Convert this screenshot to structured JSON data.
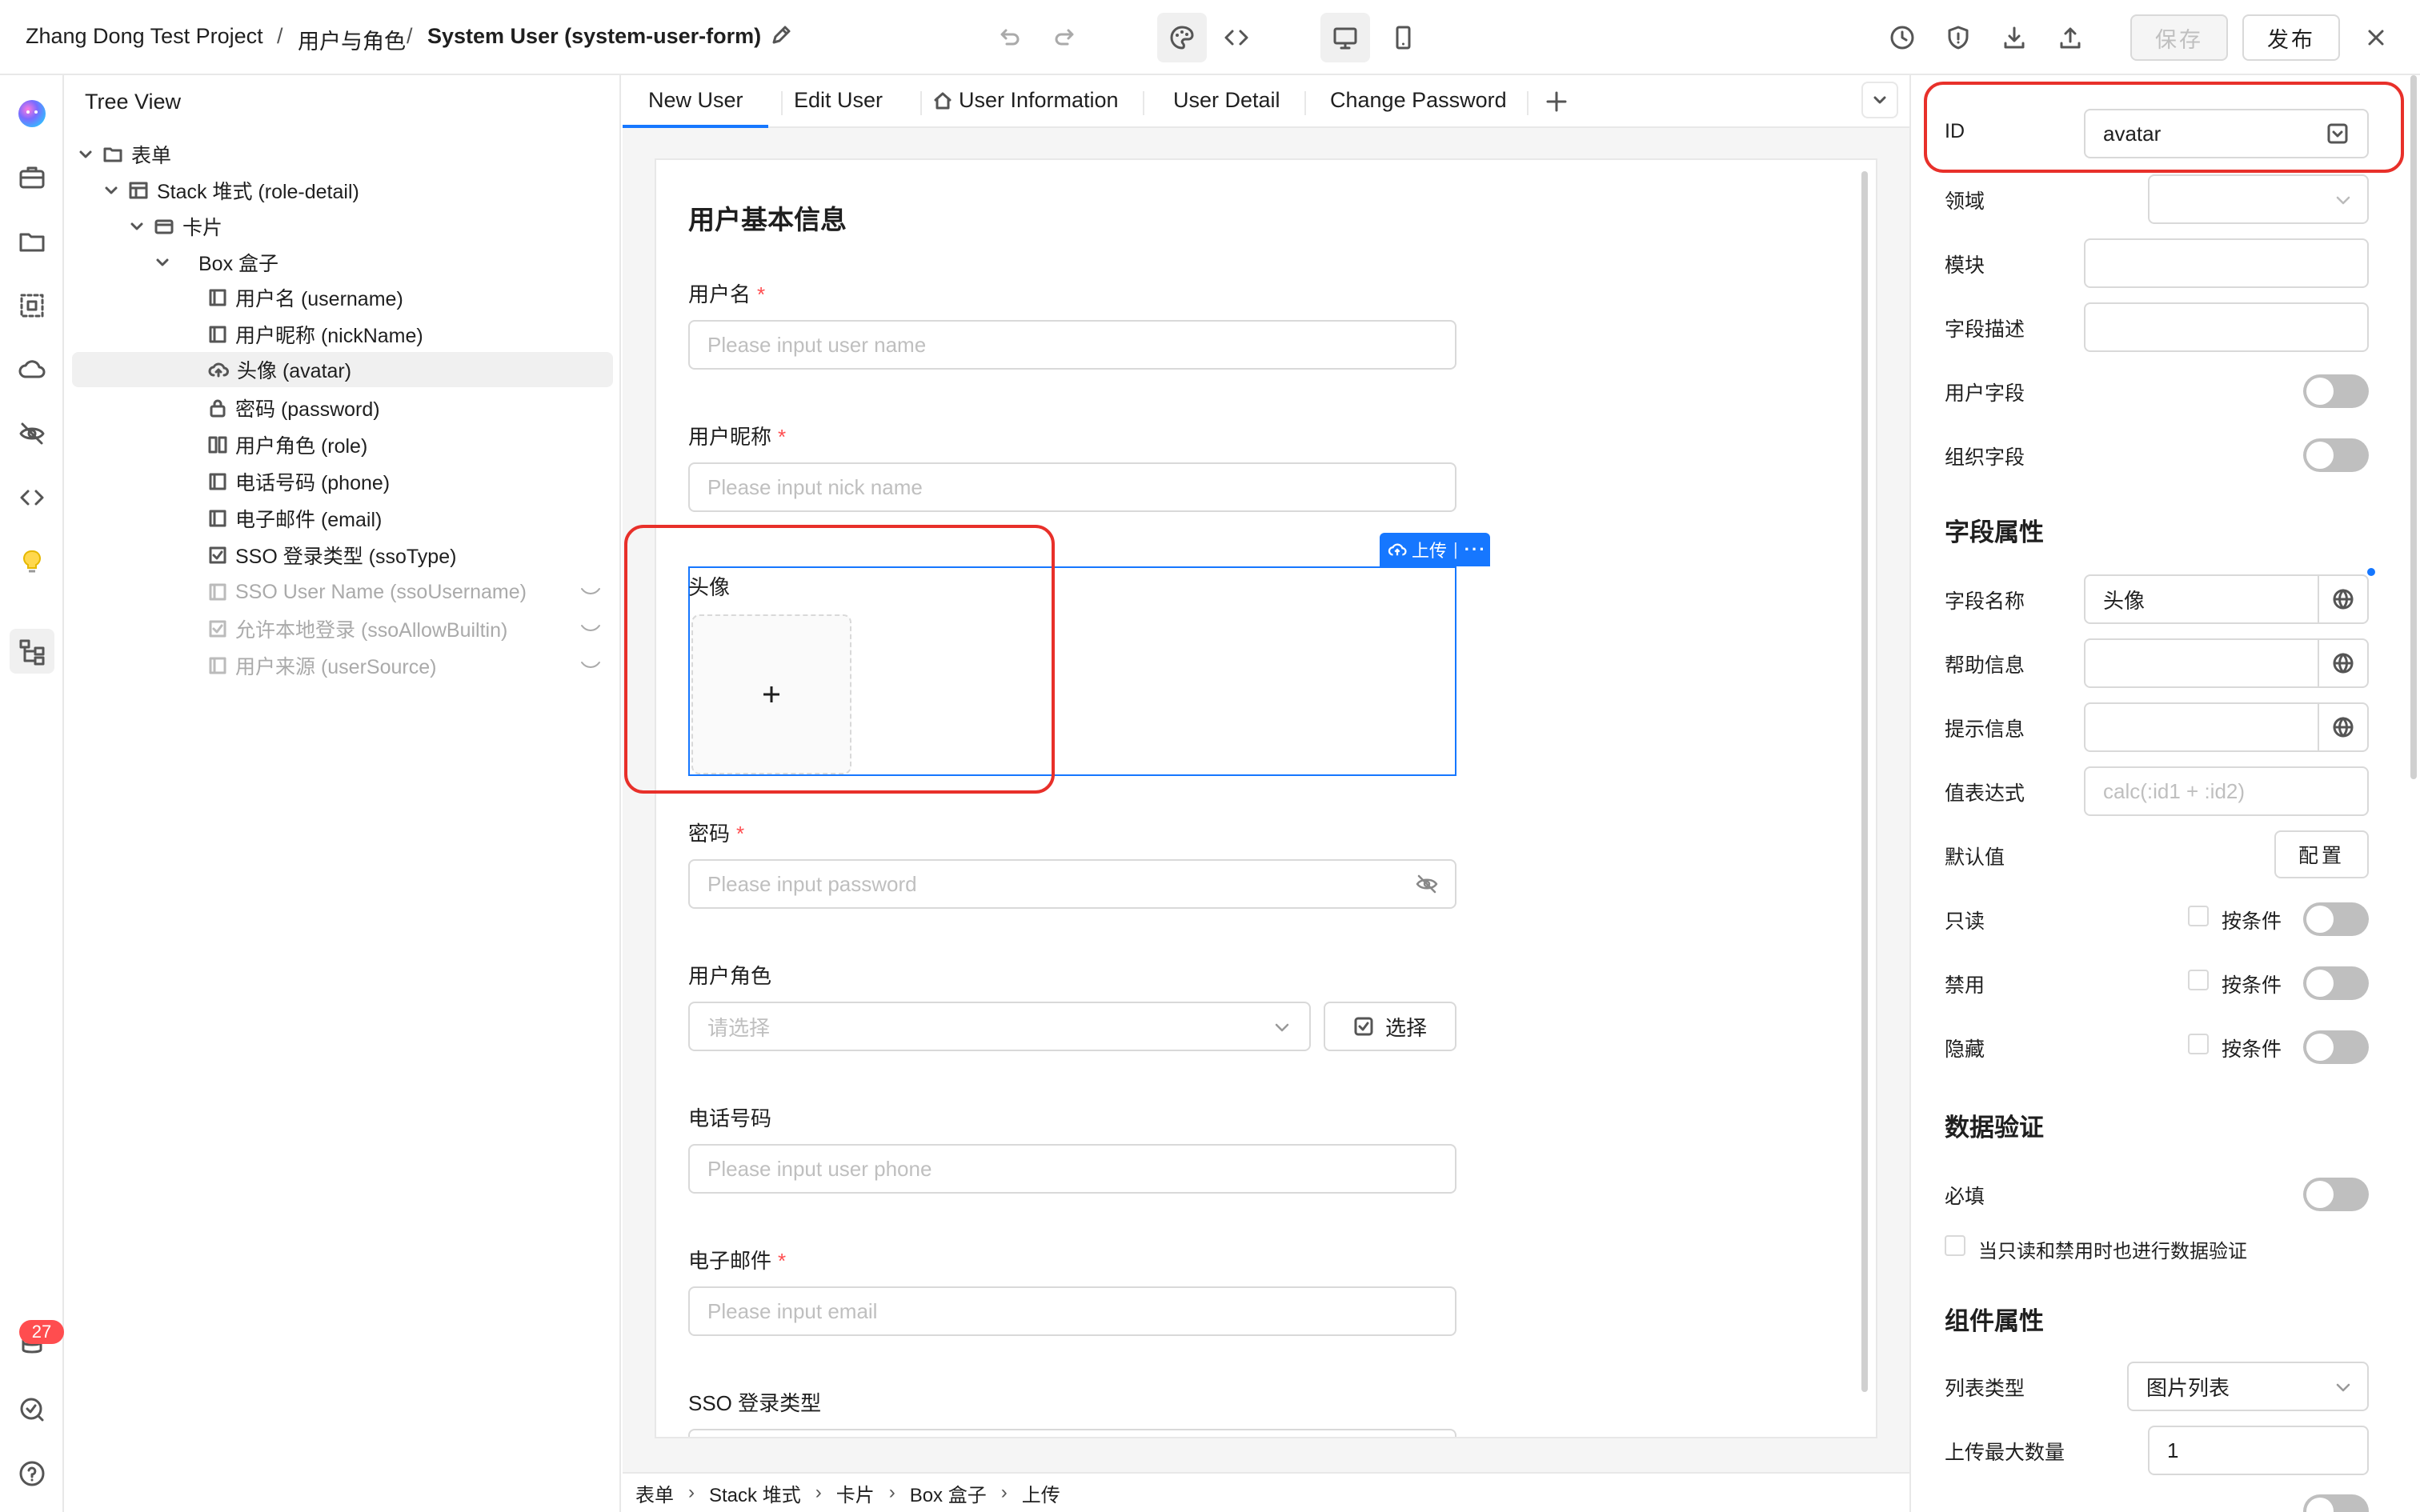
{
  "header": {
    "project": "Zhang Dong Test Project",
    "sep": "/",
    "section": "用户与角色",
    "form_title": "System User (system-user-form)",
    "save_label": "保存",
    "publish_label": "发布"
  },
  "rail": {
    "badge_count": "27"
  },
  "tree": {
    "title": "Tree View",
    "rows": [
      {
        "label": "表单"
      },
      {
        "label": "Stack 堆式 (role-detail)"
      },
      {
        "label": "卡片"
      },
      {
        "label": "Box 盒子"
      },
      {
        "label": "用户名 (username)"
      },
      {
        "label": "用户昵称 (nickName)"
      },
      {
        "label": "头像 (avatar)"
      },
      {
        "label": "密码 (password)"
      },
      {
        "label": "用户角色 (role)"
      },
      {
        "label": "电话号码 (phone)"
      },
      {
        "label": "电子邮件 (email)"
      },
      {
        "label": "SSO 登录类型 (ssoType)"
      },
      {
        "label": "SSO User Name (ssoUsername)"
      },
      {
        "label": "允许本地登录 (ssoAllowBuiltin)"
      },
      {
        "label": "用户来源 (userSource)"
      }
    ]
  },
  "tabs": [
    {
      "label": "New User"
    },
    {
      "label": "Edit User"
    },
    {
      "label": "User Information"
    },
    {
      "label": "User Detail"
    },
    {
      "label": "Change Password"
    }
  ],
  "form": {
    "section_title": "用户基本信息",
    "username": {
      "label": "用户名",
      "placeholder": "Please input user name"
    },
    "nickname": {
      "label": "用户昵称",
      "placeholder": "Please input nick name"
    },
    "avatar": {
      "label": "头像",
      "toolbar_label": "上传"
    },
    "password": {
      "label": "密码",
      "placeholder": "Please input password"
    },
    "role": {
      "label": "用户角色",
      "placeholder": "请选择",
      "select_button": "选择"
    },
    "phone": {
      "label": "电话号码",
      "placeholder": "Please input user phone"
    },
    "email": {
      "label": "电子邮件",
      "placeholder": "Please input email"
    },
    "sso": {
      "label": "SSO 登录类型"
    },
    "required_mark": "*"
  },
  "bottom_breadcrumb": [
    "表单",
    "Stack 堆式",
    "卡片",
    "Box 盒子",
    "上传"
  ],
  "props": {
    "id_label": "ID",
    "id_value": "avatar",
    "domain_label": "领域",
    "module_label": "模块",
    "field_desc_label": "字段描述",
    "user_field_label": "用户字段",
    "org_field_label": "组织字段",
    "field_attrs_title": "字段属性",
    "field_name_label": "字段名称",
    "field_name_value": "头像",
    "help_label": "帮助信息",
    "hint_label": "提示信息",
    "value_expr_label": "值表达式",
    "value_expr_placeholder": "calc(:id1 + :id2)",
    "default_label": "默认值",
    "config_button": "配置",
    "readonly_label": "只读",
    "disabled_label": "禁用",
    "hidden_label": "隐藏",
    "conditional_label": "按条件",
    "validation_title": "数据验证",
    "required_label": "必填",
    "validate_readonly_label": "当只读和禁用时也进行数据验证",
    "component_title": "组件属性",
    "list_type_label": "列表类型",
    "list_type_value": "图片列表",
    "max_upload_label": "上传最大数量",
    "max_upload_value": "1"
  },
  "colors": {
    "accent": "#1677ff",
    "highlight": "#e8302a",
    "required": "#ff4d4f"
  }
}
